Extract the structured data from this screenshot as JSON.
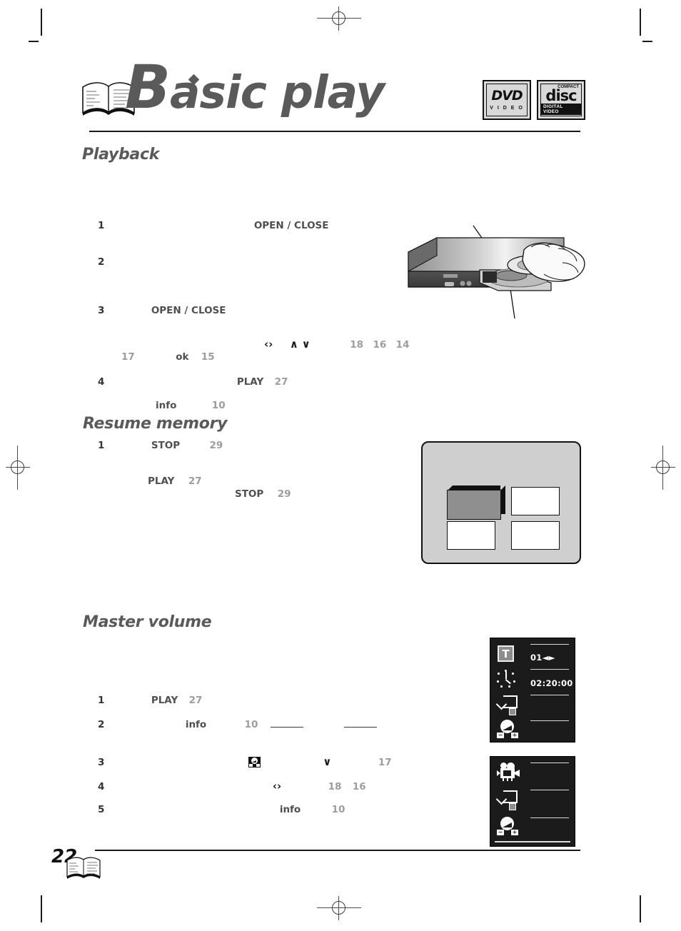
{
  "document": {
    "title": "Basic play",
    "title_first_letter": "B",
    "title_rest": "asic play",
    "page_number": "22"
  },
  "logos": [
    {
      "name": "dvd-video-logo",
      "main": "DVD",
      "sub": "V I D E O"
    },
    {
      "name": "compact-disc-logo",
      "top": "COMPACT",
      "main": "disc",
      "bottom": "DIGITAL VIDEO"
    }
  ],
  "sections": [
    {
      "id": "playback",
      "heading": "Playback",
      "steps": [
        {
          "number": "1",
          "keyword": "OPEN / CLOSE"
        },
        {
          "number": "2",
          "keyword": ""
        },
        {
          "number": "3",
          "keyword": "OPEN / CLOSE"
        }
      ],
      "nav_line": {
        "glyph_lr": "‹›",
        "glyph_up": "∧",
        "glyph_down": "∨",
        "pages": [
          "18",
          "16",
          "14"
        ]
      },
      "sub_line": {
        "page_a": "17",
        "keyword": "ok",
        "page_b": "15"
      },
      "step4": {
        "number": "4",
        "keyword": "PLAY",
        "page": "27"
      },
      "info_line": {
        "keyword": "info",
        "page": "10"
      }
    },
    {
      "id": "resume-memory",
      "heading": "Resume memory",
      "steps": [
        {
          "number": "1",
          "keyword": "STOP",
          "page": "29"
        }
      ],
      "line_play": {
        "keyword": "PLAY",
        "page": "27"
      },
      "line_stop": {
        "keyword": "STOP",
        "page": "29"
      }
    },
    {
      "id": "master-volume",
      "heading": "Master volume",
      "steps": [
        {
          "number": "1",
          "keyword": "PLAY",
          "page": "27"
        },
        {
          "number": "2",
          "keyword": "info",
          "page": "10"
        },
        {
          "number": "3",
          "keyword": "",
          "page": "17"
        },
        {
          "number": "4",
          "keyword": "",
          "pages": [
            "18",
            "16"
          ]
        },
        {
          "number": "5",
          "keyword": "info",
          "page": "10"
        }
      ]
    }
  ],
  "osd_panels": [
    {
      "name": "title-time-osd",
      "rows": [
        {
          "icon": "title-t-icon",
          "icon_label": "T",
          "value": "01◄►"
        },
        {
          "icon": "clock-icon",
          "value": "02:20:00"
        },
        {
          "icon": "repeat-icon",
          "value": ""
        },
        {
          "icon": "volume-knob-icon",
          "value": ""
        }
      ]
    },
    {
      "name": "angle-volume-osd",
      "rows": [
        {
          "icon": "camera-angle-icon",
          "value": ""
        },
        {
          "icon": "repeat-icon",
          "value": ""
        },
        {
          "icon": "volume-knob-icon",
          "value": ""
        }
      ]
    }
  ],
  "illustrations": [
    {
      "name": "dvd-player-front-with-hand",
      "caption": ""
    },
    {
      "name": "tv-menu-screen",
      "thumbnails": 4,
      "selected_index": 0
    }
  ],
  "colors": {
    "heading_gray": "#5a5a5a",
    "keyword_gray": "#4f4f4f",
    "page_ref_gray": "#9d9d9d",
    "osd_background": "#1b1b1b",
    "tv_background": "#cfcfcf"
  }
}
